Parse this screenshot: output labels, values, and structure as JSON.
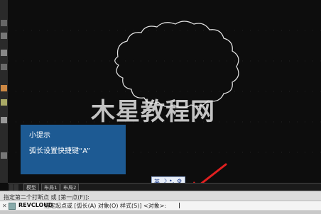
{
  "watermark": {
    "text": "木星教程网"
  },
  "tip": {
    "title": "小提示",
    "text": "弧长设置快捷键“A”"
  },
  "ime": {
    "lang": "英",
    "moon": "☽",
    "dot": "•,",
    "gear": "⚙"
  },
  "layout_tabs": [
    "模型",
    "布局1",
    "布局2"
  ],
  "command": {
    "history": "指定第二个打断点 或 [第一点(F)]:",
    "close_glyph": "✕",
    "name": "REVCLOUD",
    "prompt": "指定起点或 [弧长(A) 对象(O) 样式(S)] <对象>:"
  },
  "colors": {
    "tip_bg": "#1d5a93",
    "arrow": "#e02020",
    "canvas_bg": "#0d0d0d"
  },
  "icons": [
    "pan-icon",
    "zoom-icon",
    "orbit-icon",
    "layer-icon",
    "line-icon",
    "text-icon",
    "hatch-icon",
    "properties-icon"
  ]
}
